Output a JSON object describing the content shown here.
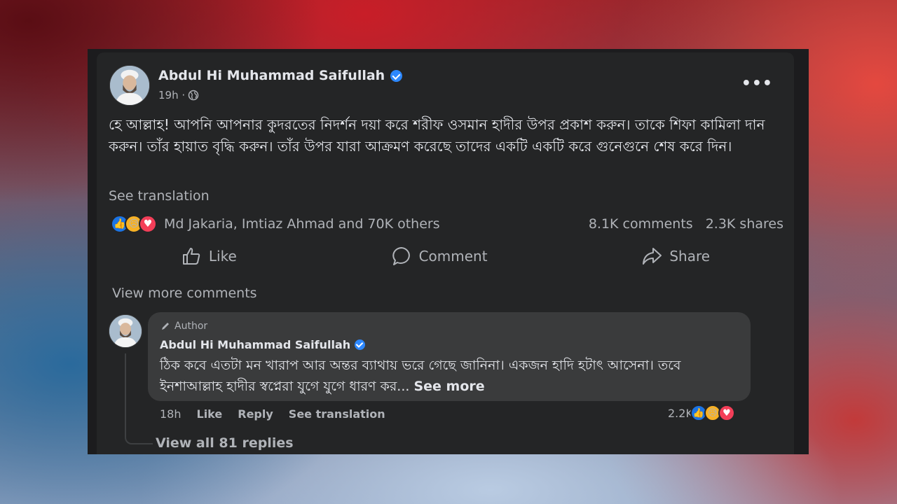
{
  "post": {
    "author": "Abdul Hi Muhammad Saifullah",
    "time": "19h ·",
    "text": "হে আল্লাহ! আপনি আপনার কুদরতের নিদর্শন দয়া করে শরীফ ওসমান হাদীর উপর প্রকাশ করুন। তাকে শিফা কামিলা দান করুন। তাঁর হায়াত বৃদ্ধি করুন। তাঁর উপর যারা আক্রমণ করেছে তাদের একটি একটি করে গুনেগুনে শেষ করে দিন।",
    "see_translation": "See translation",
    "more_label": "•••",
    "reactions_text": "Md Jakaria, Imtiaz Ahmad and 70K others",
    "comments_count": "8.1K comments",
    "shares_count": "2.3K shares"
  },
  "actions": {
    "like": "Like",
    "comment": "Comment",
    "share": "Share"
  },
  "comments_section": {
    "view_more": "View more comments",
    "comment": {
      "badge": "Author",
      "author": "Abdul Hi Muhammad Saifullah",
      "text": "ঠিক কবে এতটা মন খারাপ আর অন্তর ব্যাথায় ভরে গেছে জানিনা। একজন হাদি হটাৎ আসেনা। তবে ইনশাআল্লাহ হাদীর স্বপ্নেরা যুগে যুগে ধারণ কর...",
      "see_more": "See more",
      "time": "18h",
      "like": "Like",
      "reply": "Reply",
      "see_translation": "See translation",
      "reaction_count": "2.2K"
    },
    "view_replies": "View all 81 replies"
  },
  "colors": {
    "card_bg": "#242526",
    "bubble_bg": "#3a3b3c",
    "primary_text": "#e4e6eb",
    "secondary_text": "#b0b3b8",
    "verified": "#2d88ff",
    "like_blue": "#1b74e4",
    "love_red": "#f33e58",
    "sad_yellow": "#f7b125"
  },
  "icons": [
    "globe-icon",
    "verified-icon",
    "more-icon",
    "like-icon",
    "comment-icon",
    "share-icon",
    "pen-icon",
    "like-reaction-icon",
    "sad-reaction-icon",
    "love-reaction-icon"
  ]
}
